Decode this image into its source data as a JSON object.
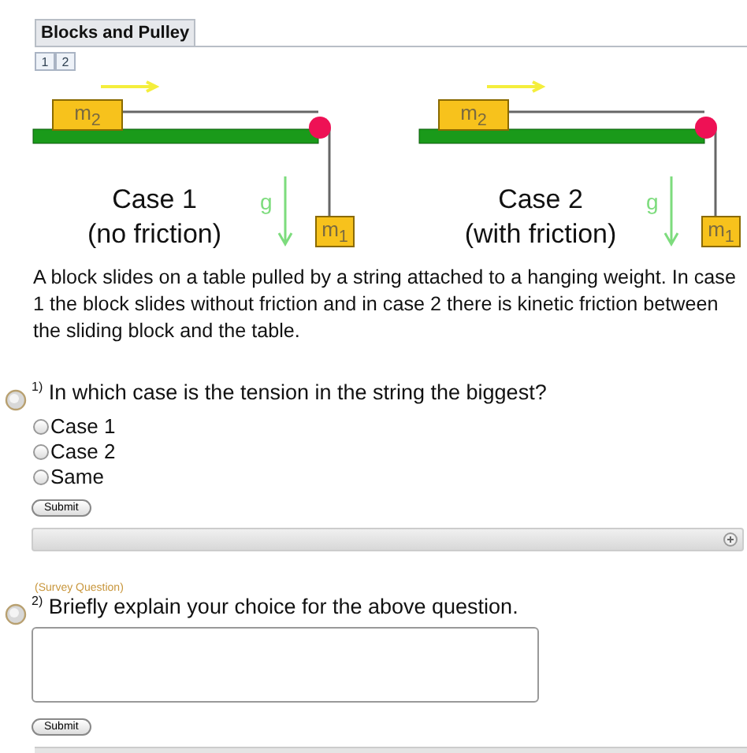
{
  "title_tab": "Blocks and Pulley",
  "page_tabs": [
    {
      "label": "1",
      "selected": false
    },
    {
      "label": "2",
      "selected": false
    }
  ],
  "cases": [
    {
      "title": "Case 1",
      "subtitle": "(no friction)",
      "block_top": "m$_{2}$",
      "block_hanging": "m$_{1}$",
      "gravity": "g"
    },
    {
      "title": "Case 2",
      "subtitle": "(with friction)",
      "block_top": "m$_{2}$",
      "block_hanging": "m$_{1}$",
      "gravity": "g"
    }
  ],
  "description": "A block slides on a table pulled by a string attached to a hanging weight. In case 1 the block slides without friction and in case 2 there is kinetic friction between the sliding block and the table.",
  "questions": [
    {
      "kind": "choice",
      "number": "1)",
      "text": "In which case is the tension in the string the biggest?",
      "options": [
        {
          "label": "Case 1",
          "selected": false
        },
        {
          "label": "Case 2",
          "selected": false
        },
        {
          "label": "Same",
          "selected": false
        }
      ],
      "submit": "Submit"
    },
    {
      "kind": "text",
      "tag": "(Survey Question)",
      "number": "2)",
      "text": "Briefly explain your choice for the above question.",
      "submit": "Submit"
    }
  ]
}
